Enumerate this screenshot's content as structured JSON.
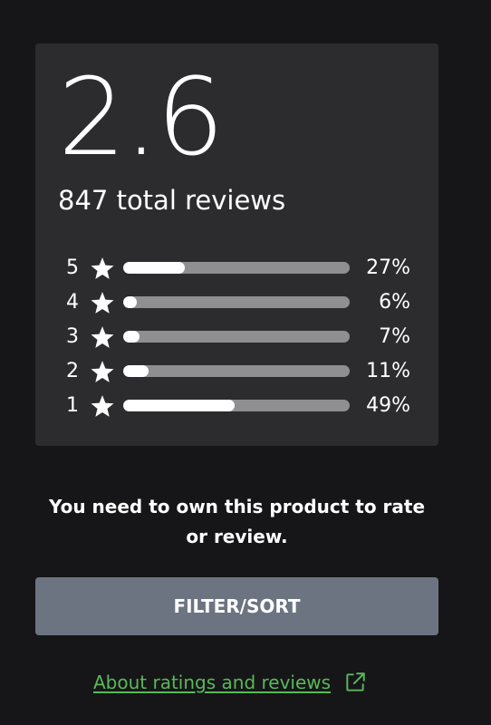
{
  "summary": {
    "average_rating": "2.6",
    "total_reviews_text": "847 total reviews"
  },
  "rating_breakdown": [
    {
      "stars": "5",
      "percent_text": "27%",
      "percent": 27,
      "star_icon": "star-icon"
    },
    {
      "stars": "4",
      "percent_text": "6%",
      "percent": 6,
      "star_icon": "star-icon"
    },
    {
      "stars": "3",
      "percent_text": "7%",
      "percent": 7,
      "star_icon": "star-icon"
    },
    {
      "stars": "2",
      "percent_text": "11%",
      "percent": 11,
      "star_icon": "star-icon"
    },
    {
      "stars": "1",
      "percent_text": "49%",
      "percent": 49,
      "star_icon": "star-icon"
    }
  ],
  "own_message": "You need to own this product to rate or review.",
  "filter_button": {
    "label": "FILTER/SORT"
  },
  "about_link": {
    "label": "About ratings and reviews",
    "icon": "external-link-icon"
  },
  "colors": {
    "background": "#161618",
    "card": "#2c2c2e",
    "bar_track": "#8f8f91",
    "bar_fill": "#ffffff",
    "button": "#6c7482",
    "link": "#5ab85a"
  }
}
